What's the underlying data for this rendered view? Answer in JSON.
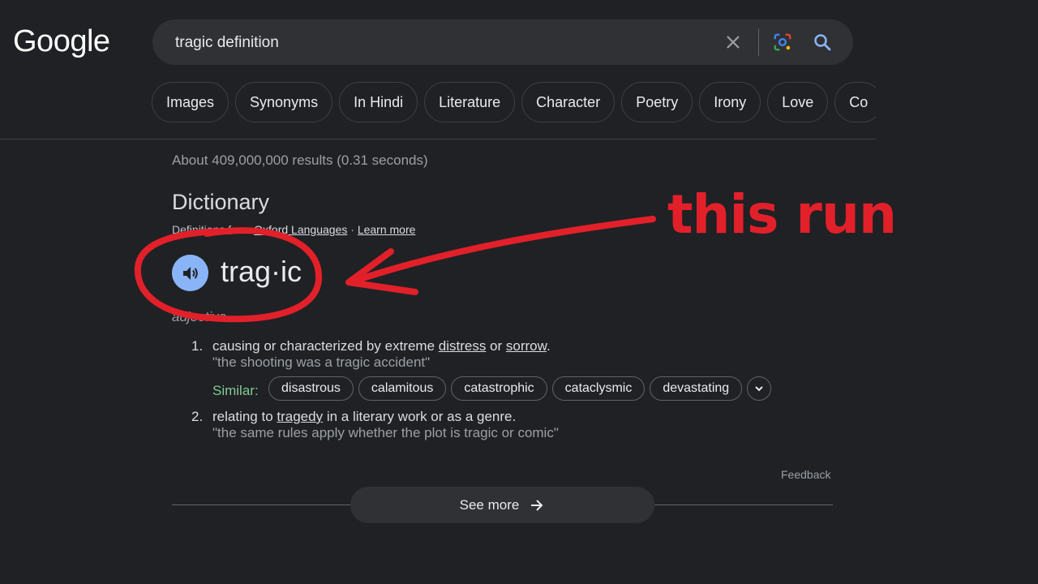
{
  "logo": "Google",
  "search": {
    "query": "tragic definition"
  },
  "chips": [
    "Images",
    "Synonyms",
    "In Hindi",
    "Literature",
    "Character",
    "Poetry",
    "Irony",
    "Love",
    "Co"
  ],
  "stats": "About 409,000,000 results (0.31 seconds)",
  "dictionary": {
    "title": "Dictionary",
    "source_prefix": "Definitions from",
    "source_name": "Oxford Languages",
    "separator": "·",
    "learn_more": "Learn more",
    "word": "trag·ic",
    "part_of_speech": "adjective",
    "definitions": [
      {
        "number": "1.",
        "text_a": "causing or characterized by extreme ",
        "link_1": "distress",
        "text_b": " or ",
        "link_2": "sorrow",
        "text_c": ".",
        "example": "\"the shooting was a tragic accident\""
      },
      {
        "number": "2.",
        "text_a": "relating to ",
        "link_1": "tragedy",
        "text_b": " in a literary work or as a genre.",
        "example": "\"the same rules apply whether the plot is tragic or comic\""
      }
    ],
    "similar_label": "Similar:",
    "similar": [
      "disastrous",
      "calamitous",
      "catastrophic",
      "cataclysmic",
      "devastating"
    ],
    "feedback": "Feedback",
    "see_more": "See more"
  },
  "annotation": {
    "text": "this run",
    "color": "#e2202a"
  },
  "colors": {
    "background": "#202124",
    "accent_blue": "#8ab4f8",
    "similar_green": "#81c995"
  }
}
